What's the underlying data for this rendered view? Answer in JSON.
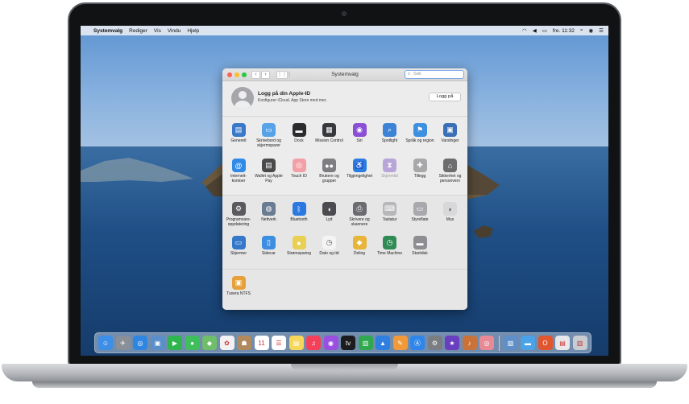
{
  "menubar": {
    "apple": "",
    "app": "Systemvalg",
    "items": [
      "Rediger",
      "Vis",
      "Vindu",
      "Hjelp"
    ],
    "clock": "fre. 11:32"
  },
  "window": {
    "title": "Systemvalg",
    "search_placeholder": "Søk",
    "back": "‹",
    "forward": "›",
    "grid": "⋮⋮⋮"
  },
  "apple_id": {
    "title": "Logg på din Apple-ID",
    "subtitle": "Konfigurer iCloud, App Store med mer.",
    "button": "Logg på"
  },
  "section1": [
    {
      "label": "Generelt",
      "icon": "general-icon",
      "color": "#3a79c9",
      "glyph": "▤"
    },
    {
      "label": "Skrivebord og skjermsparer",
      "icon": "desktop-icon",
      "color": "#56a3e8",
      "glyph": "▭"
    },
    {
      "label": "Dock",
      "icon": "dock-icon",
      "color": "#2b2b2e",
      "glyph": "▬"
    },
    {
      "label": "Mission Control",
      "icon": "mission-control-icon",
      "color": "#37383c",
      "glyph": "▦"
    },
    {
      "label": "Siri",
      "icon": "siri-icon",
      "color": "#8a4fd6",
      "glyph": "◉"
    },
    {
      "label": "Spotlight",
      "icon": "spotlight-icon",
      "color": "#3c83d6",
      "glyph": "⌕"
    },
    {
      "label": "Språk og region",
      "icon": "language-icon",
      "color": "#3d8fe0",
      "glyph": "⚑"
    },
    {
      "label": "Varslinger",
      "icon": "notifications-icon",
      "color": "#3a6fb8",
      "glyph": "▣"
    },
    {
      "label": "Internett-kontoer",
      "icon": "internet-accounts-icon",
      "color": "#2f8ae8",
      "glyph": "@"
    },
    {
      "label": "Wallet og Apple Pay",
      "icon": "wallet-icon",
      "color": "#4a4a4d",
      "glyph": "▤"
    },
    {
      "label": "Touch ID",
      "icon": "touch-id-icon",
      "color": "#f2a0a8",
      "glyph": "◎"
    },
    {
      "label": "Brukere og grupper",
      "icon": "users-icon",
      "color": "#7d7d82",
      "glyph": "●●"
    },
    {
      "label": "Tilgjengelighet",
      "icon": "accessibility-icon",
      "color": "#2a7ce0",
      "glyph": "♿"
    },
    {
      "label": "Skjermtid",
      "icon": "screen-time-icon",
      "color": "#b9a6d9",
      "glyph": "⧗",
      "dim": true
    },
    {
      "label": "Tillegg",
      "icon": "extensions-icon",
      "color": "#a8a8ab",
      "glyph": "✚"
    },
    {
      "label": "Sikkerhet og personvern",
      "icon": "security-icon",
      "color": "#6d6d70",
      "glyph": "⌂"
    }
  ],
  "section2": [
    {
      "label": "Programvare-oppdatering",
      "icon": "software-update-icon",
      "color": "#5a5a5f",
      "glyph": "⚙"
    },
    {
      "label": "Nettverk",
      "icon": "network-icon",
      "color": "#6a7c92",
      "glyph": "◍"
    },
    {
      "label": "Bluetooth",
      "icon": "bluetooth-icon",
      "color": "#2a78e0",
      "glyph": "ᛒ"
    },
    {
      "label": "Lyd",
      "icon": "sound-icon",
      "color": "#4c4c50",
      "glyph": "◖"
    },
    {
      "label": "Skrivere og skannere",
      "icon": "printer-icon",
      "color": "#6b6b70",
      "glyph": "⎙"
    },
    {
      "label": "Tastatur",
      "icon": "keyboard-icon",
      "color": "#b7b7ba",
      "glyph": "⌨"
    },
    {
      "label": "Styreflate",
      "icon": "trackpad-icon",
      "color": "#a9a9ad",
      "glyph": "▭"
    },
    {
      "label": "Mus",
      "icon": "mouse-icon",
      "color": "#d8d8da",
      "glyph": "◗"
    },
    {
      "label": "Skjermer",
      "icon": "displays-icon",
      "color": "#3577c8",
      "glyph": "▭"
    },
    {
      "label": "Sidecar",
      "icon": "sidecar-icon",
      "color": "#3d8ee0",
      "glyph": "▯"
    },
    {
      "label": "Strømsparing",
      "icon": "energy-icon",
      "color": "#e9cf52",
      "glyph": "●"
    },
    {
      "label": "Dato og tid",
      "icon": "clock-icon",
      "color": "#f4f4f4",
      "glyph": "◷"
    },
    {
      "label": "Deling",
      "icon": "sharing-icon",
      "color": "#e8b43a",
      "glyph": "◆"
    },
    {
      "label": "Time Machine",
      "icon": "time-machine-icon",
      "color": "#2f8a54",
      "glyph": "◷"
    },
    {
      "label": "Startdisk",
      "icon": "startup-disk-icon",
      "color": "#8d8d92",
      "glyph": "▬"
    }
  ],
  "section3": [
    {
      "label": "Tuxera NTFS",
      "icon": "ntfs-icon",
      "color": "#e6a13a",
      "glyph": "▣"
    }
  ],
  "dock": [
    {
      "name": "finder-icon",
      "color": "#3d8ee6",
      "glyph": "☺"
    },
    {
      "name": "launchpad-icon",
      "color": "#8a8f98",
      "glyph": "✈"
    },
    {
      "name": "safari-icon",
      "color": "#2f86e0",
      "glyph": "◎"
    },
    {
      "name": "photos-viewer-icon",
      "color": "#5a8fc9",
      "glyph": "▣"
    },
    {
      "name": "facetime-icon",
      "color": "#2fb54d",
      "glyph": "▶"
    },
    {
      "name": "messages-icon",
      "color": "#3fbf5b",
      "glyph": "●"
    },
    {
      "name": "maps-icon",
      "color": "#6fbf6a",
      "glyph": "◆"
    },
    {
      "name": "photos-icon",
      "color": "#f2f2f2",
      "glyph": "✿"
    },
    {
      "name": "contacts-icon",
      "color": "#b08a5c",
      "glyph": "☗"
    },
    {
      "name": "calendar-icon",
      "color": "#ffffff",
      "glyph": "11"
    },
    {
      "name": "reminders-icon",
      "color": "#ffffff",
      "glyph": "☰"
    },
    {
      "name": "notes-icon",
      "color": "#f7d75a",
      "glyph": "▤"
    },
    {
      "name": "music-icon",
      "color": "#f5405a",
      "glyph": "♫"
    },
    {
      "name": "podcasts-icon",
      "color": "#9a4fe0",
      "glyph": "◉"
    },
    {
      "name": "tv-icon",
      "color": "#1c1c1e",
      "glyph": "tv"
    },
    {
      "name": "numbers-icon",
      "color": "#2fa84f",
      "glyph": "▥"
    },
    {
      "name": "keynote-icon",
      "color": "#2f7fe0",
      "glyph": "▲"
    },
    {
      "name": "pages-icon",
      "color": "#f29a3a",
      "glyph": "✎"
    },
    {
      "name": "app-store-icon",
      "color": "#2f86ea",
      "glyph": "Ⓐ"
    },
    {
      "name": "system-preferences-icon",
      "color": "#7b7d82",
      "glyph": "⚙"
    },
    {
      "name": "imovie-icon",
      "color": "#6a3fbf",
      "glyph": "★"
    },
    {
      "name": "garageband-icon",
      "color": "#c9733a",
      "glyph": "♪"
    },
    {
      "name": "touch-id-dock-icon",
      "color": "#e88a96",
      "glyph": "◎"
    },
    {
      "name": "preview-icon",
      "color": "#5f8fc9",
      "glyph": "▧"
    },
    {
      "name": "folder-icon",
      "color": "#4aa3e8",
      "glyph": "▬"
    },
    {
      "name": "office-icon",
      "color": "#e0562f",
      "glyph": "O"
    },
    {
      "name": "documents-icon",
      "color": "#e8e8ea",
      "glyph": "▤"
    },
    {
      "name": "trash-icon",
      "color": "#c9ccd1",
      "glyph": "▥"
    }
  ],
  "hardware": {
    "brand": "MacBook Pro"
  }
}
